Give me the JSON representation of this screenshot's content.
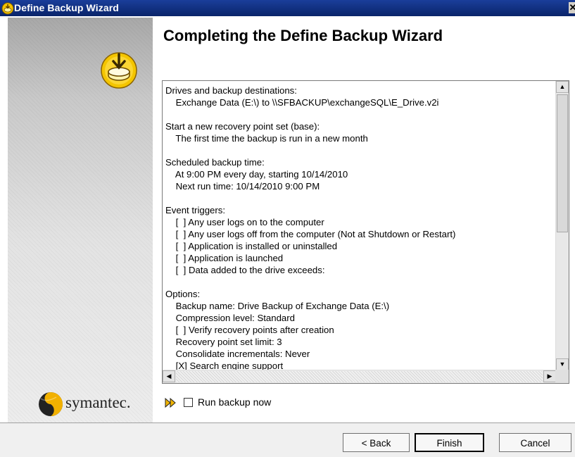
{
  "window": {
    "title": "Define Backup Wizard",
    "close_glyph": "✕"
  },
  "page": {
    "heading": "Completing the Define Backup Wizard"
  },
  "sidebar": {
    "icon": "backup-disk-icon",
    "logo_text": "symantec."
  },
  "summary": {
    "sections": [
      {
        "title": "Drives and backup destinations:",
        "lines": [
          "Exchange Data (E:\\) to \\\\SFBACKUP\\exchangeSQL\\E_Drive.v2i"
        ]
      },
      {
        "title": "Start a new recovery point set (base):",
        "lines": [
          "The first time the backup is run in a new month"
        ]
      },
      {
        "title": "Scheduled backup time:",
        "lines": [
          "At 9:00 PM every day, starting 10/14/2010",
          "Next run time: 10/14/2010 9:00 PM"
        ]
      },
      {
        "title": "Event triggers:",
        "lines": [
          "[  ] Any user logs on to the computer",
          "[  ] Any user logs off from the computer (Not at Shutdown or Restart)",
          "[  ] Application is installed or uninstalled",
          "[  ] Application is launched",
          "[  ] Data added to the drive exceeds:"
        ]
      },
      {
        "title": "Options:",
        "lines": [
          "Backup name: Drive Backup of Exchange Data (E:\\)",
          "Compression level: Standard",
          "[  ] Verify recovery points after creation",
          "Recovery point set limit: 3",
          "Consolidate incrementals: Never",
          "[X] Search engine support"
        ]
      }
    ]
  },
  "run_now": {
    "label": "Run backup now",
    "checked": false
  },
  "buttons": {
    "back": "< Back",
    "finish": "Finish",
    "cancel": "Cancel"
  }
}
